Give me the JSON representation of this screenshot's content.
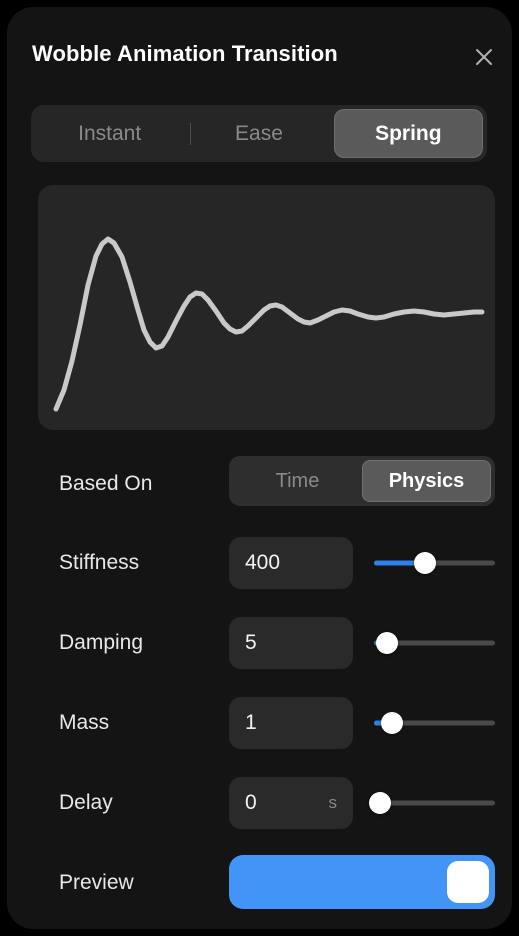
{
  "panel": {
    "title": "Wobble Animation Transition",
    "close_icon": "close-icon"
  },
  "transition_type": {
    "options": [
      "Instant",
      "Ease",
      "Spring"
    ],
    "selected": "Spring"
  },
  "graph": {
    "curve_color": "#c9c9c9",
    "background": "#262626"
  },
  "chart_data": {
    "type": "line",
    "title": "",
    "xlabel": "",
    "ylabel": "",
    "description": "Damped spring oscillation preview curve",
    "xlim": [
      0,
      457
    ],
    "ylim": [
      245,
      0
    ],
    "series": [
      {
        "name": "spring-response",
        "points": [
          [
            18,
            224
          ],
          [
            26,
            205
          ],
          [
            34,
            176
          ],
          [
            42,
            140
          ],
          [
            50,
            100
          ],
          [
            58,
            71
          ],
          [
            64,
            59
          ],
          [
            70,
            54
          ],
          [
            76,
            58
          ],
          [
            84,
            72
          ],
          [
            92,
            97
          ],
          [
            100,
            125
          ],
          [
            106,
            145
          ],
          [
            112,
            157
          ],
          [
            118,
            163
          ],
          [
            124,
            161
          ],
          [
            130,
            152
          ],
          [
            138,
            136
          ],
          [
            146,
            121
          ],
          [
            152,
            112
          ],
          [
            158,
            108
          ],
          [
            164,
            109
          ],
          [
            170,
            115
          ],
          [
            178,
            126
          ],
          [
            186,
            138
          ],
          [
            192,
            144
          ],
          [
            198,
            147
          ],
          [
            204,
            146
          ],
          [
            210,
            141
          ],
          [
            218,
            133
          ],
          [
            226,
            125
          ],
          [
            232,
            121
          ],
          [
            238,
            120
          ],
          [
            244,
            122
          ],
          [
            252,
            128
          ],
          [
            260,
            134
          ],
          [
            266,
            137
          ],
          [
            272,
            138
          ],
          [
            280,
            135
          ],
          [
            288,
            131
          ],
          [
            296,
            127
          ],
          [
            304,
            125
          ],
          [
            312,
            126
          ],
          [
            320,
            129
          ],
          [
            330,
            132
          ],
          [
            338,
            133
          ],
          [
            346,
            132
          ],
          [
            356,
            129
          ],
          [
            366,
            127
          ],
          [
            376,
            126
          ],
          [
            386,
            127
          ],
          [
            396,
            129
          ],
          [
            406,
            130
          ],
          [
            416,
            129
          ],
          [
            426,
            128
          ],
          [
            436,
            127
          ],
          [
            444,
            127
          ]
        ]
      }
    ],
    "grid": false,
    "legend": false
  },
  "rows": [
    {
      "name": "based-on",
      "label": "Based On",
      "control": "segmented",
      "options": [
        "Time",
        "Physics"
      ],
      "selected": "Physics"
    },
    {
      "name": "stiffness",
      "label": "Stiffness",
      "control": "number-slider",
      "value": "400",
      "unit": "",
      "slider_percent": 42
    },
    {
      "name": "damping",
      "label": "Damping",
      "control": "number-slider",
      "value": "5",
      "unit": "",
      "slider_percent": 11
    },
    {
      "name": "mass",
      "label": "Mass",
      "control": "number-slider",
      "value": "1",
      "unit": "",
      "slider_percent": 15
    },
    {
      "name": "delay",
      "label": "Delay",
      "control": "number-slider",
      "value": "0",
      "unit": "s",
      "slider_percent": 5
    },
    {
      "name": "preview",
      "label": "Preview",
      "control": "toggle",
      "state": "on"
    }
  ],
  "colors": {
    "accent_blue": "#4294f7",
    "slider_fill": "#2f80e8",
    "panel_bg": "#141414",
    "field_bg": "#2a2a2a",
    "segment_active": "#5a5a5a"
  }
}
